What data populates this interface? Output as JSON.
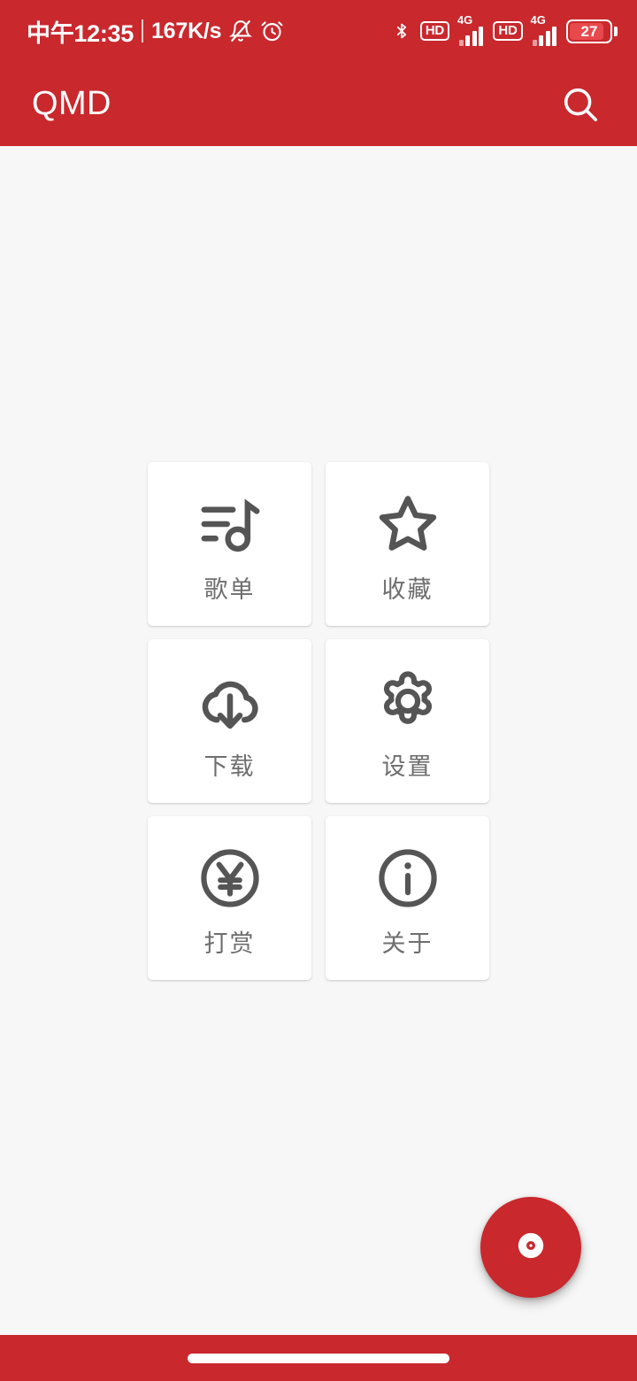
{
  "status_bar": {
    "clock": "中午12:35",
    "network_speed": "167K/s",
    "mute_icon": "bell-muted-icon",
    "alarm_icon": "alarm-clock-icon",
    "bluetooth_icon": "bluetooth-icon",
    "hd_badge_1": "HD",
    "signal_1_label": "4G",
    "hd_badge_2": "HD",
    "signal_2_label": "4G",
    "battery_level": "27",
    "background_color": "#c9282d",
    "foreground_color": "#ffffff"
  },
  "app_bar": {
    "title": "QMD",
    "search_icon": "search-icon",
    "background_color": "#c9282d"
  },
  "main": {
    "background_color": "#f7f7f7",
    "tiles": [
      {
        "label": "歌单",
        "icon": "playlist-music-icon"
      },
      {
        "label": "收藏",
        "icon": "star-outline-icon"
      },
      {
        "label": "下载",
        "icon": "cloud-download-icon"
      },
      {
        "label": "设置",
        "icon": "gear-icon"
      },
      {
        "label": "打赏",
        "icon": "yen-circle-icon"
      },
      {
        "label": "关于",
        "icon": "info-circle-icon"
      }
    ],
    "tile_label_color": "#6e6e6e",
    "tile_background_color": "#ffffff"
  },
  "fab": {
    "icon": "vinyl-record-icon",
    "background_color": "#c9282d"
  },
  "nav_bar": {
    "gesture_pill": "home-gesture-pill",
    "background_color": "#c9282d"
  }
}
